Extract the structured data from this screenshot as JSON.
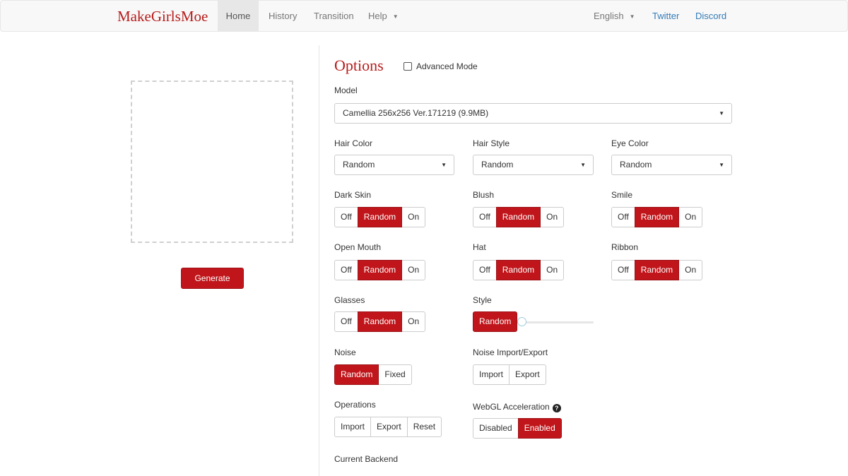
{
  "nav": {
    "brand": "MakeGirlsMoe",
    "home": "Home",
    "history": "History",
    "transition": "Transition",
    "help": "Help",
    "language": "English",
    "twitter": "Twitter",
    "discord": "Discord"
  },
  "generate_label": "Generate",
  "options": {
    "title": "Options",
    "advanced_mode": "Advanced Mode",
    "model_label": "Model",
    "model_value": "Camellia 256x256 Ver.171219 (9.9MB)",
    "hair_color": {
      "label": "Hair Color",
      "value": "Random"
    },
    "hair_style": {
      "label": "Hair Style",
      "value": "Random"
    },
    "eye_color": {
      "label": "Eye Color",
      "value": "Random"
    },
    "toggle_labels": {
      "off": "Off",
      "random": "Random",
      "on": "On"
    },
    "dark_skin": "Dark Skin",
    "blush": "Blush",
    "smile": "Smile",
    "open_mouth": "Open Mouth",
    "hat": "Hat",
    "ribbon": "Ribbon",
    "glasses": "Glasses",
    "style": {
      "label": "Style",
      "button": "Random"
    },
    "noise": {
      "label": "Noise",
      "random": "Random",
      "fixed": "Fixed"
    },
    "noise_io": {
      "label": "Noise Import/Export",
      "import": "Import",
      "export": "Export"
    },
    "operations": {
      "label": "Operations",
      "import": "Import",
      "export": "Export",
      "reset": "Reset"
    },
    "webgl": {
      "label": "WebGL Acceleration",
      "disabled": "Disabled",
      "enabled": "Enabled"
    },
    "current_backend": "Current Backend"
  },
  "colors": {
    "accent": "#c0161b",
    "brand": "#b71c1c",
    "link": "#337ab7"
  }
}
